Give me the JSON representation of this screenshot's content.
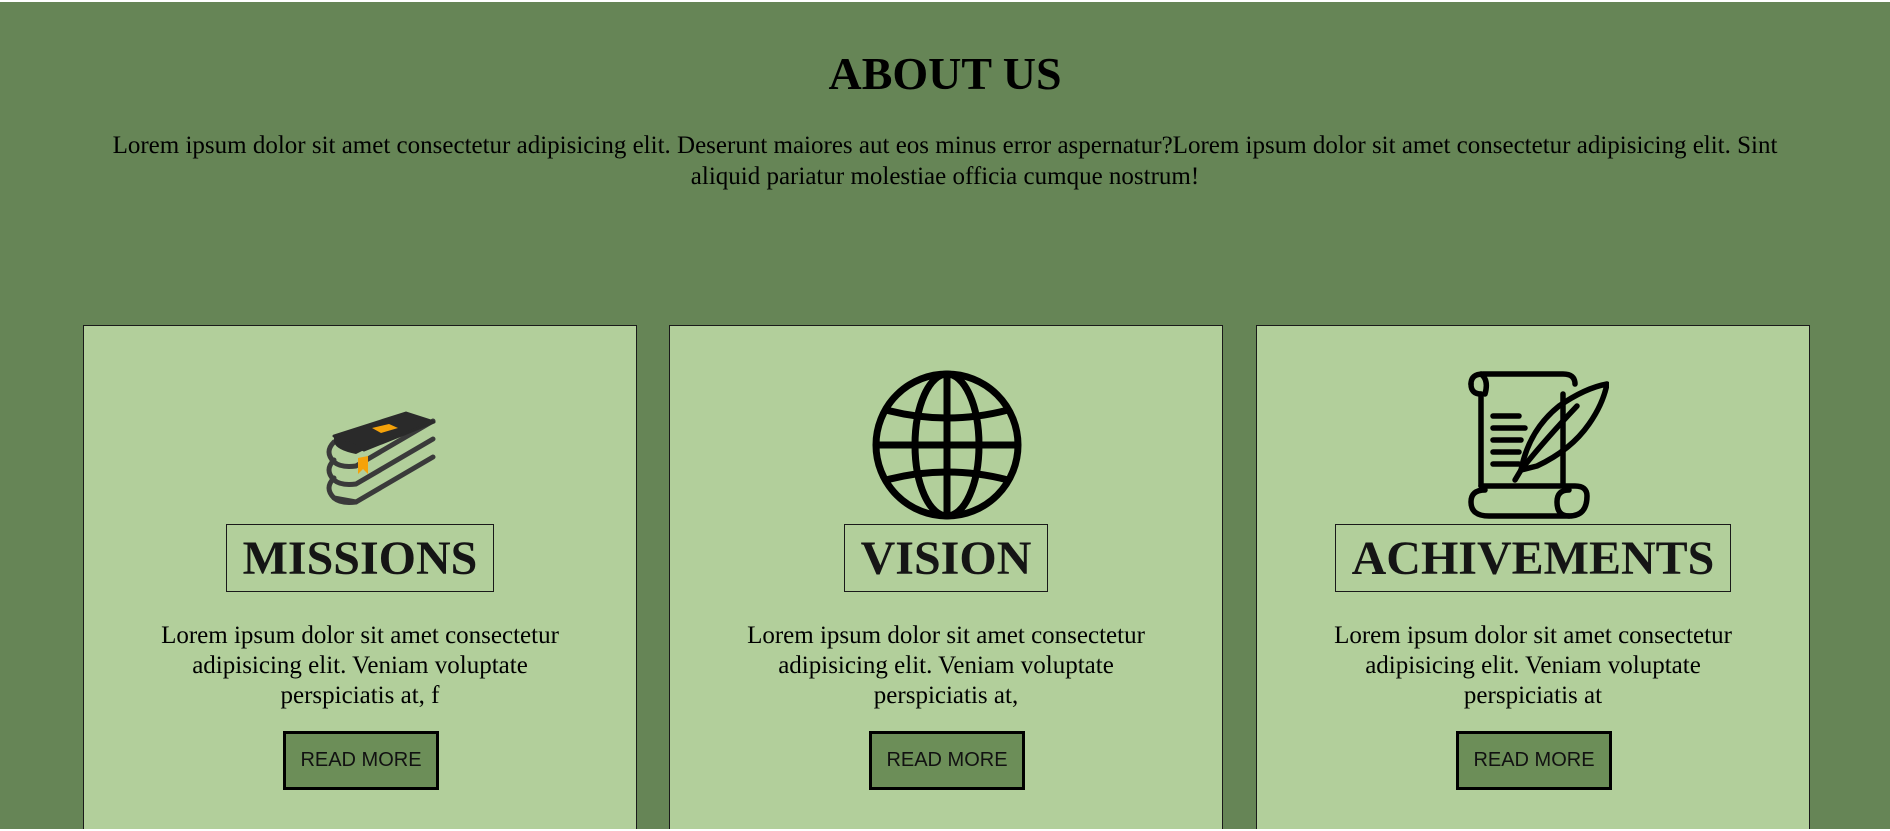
{
  "colors": {
    "page_background": "#668556",
    "card_background": "#b2cf9b",
    "button_background": "#6c8e58",
    "book_accent": "#f5a20a"
  },
  "about": {
    "title": "ABOUT US",
    "text": "Lorem ipsum dolor sit amet consectetur adipisicing elit. Deserunt maiores aut eos minus error aspernatur?Lorem ipsum dolor sit amet consectetur adipisicing elit. Sint aliquid pariatur molestiae officia cumque nostrum!"
  },
  "cards": [
    {
      "icon": "books-icon",
      "title": "MISSIONS",
      "text": "Lorem ipsum dolor sit amet consectetur adipisicing elit. Veniam voluptate perspiciatis at, f",
      "button_label": "READ MORE"
    },
    {
      "icon": "globe-icon",
      "title": "VISION",
      "text": "Lorem ipsum dolor sit amet consectetur adipisicing elit. Veniam voluptate perspiciatis at,",
      "button_label": "READ MORE"
    },
    {
      "icon": "scroll-quill-icon",
      "title": "ACHIVEMENTS",
      "text": "Lorem ipsum dolor sit amet consectetur adipisicing elit. Veniam voluptate perspiciatis at",
      "button_label": "READ MORE"
    }
  ]
}
